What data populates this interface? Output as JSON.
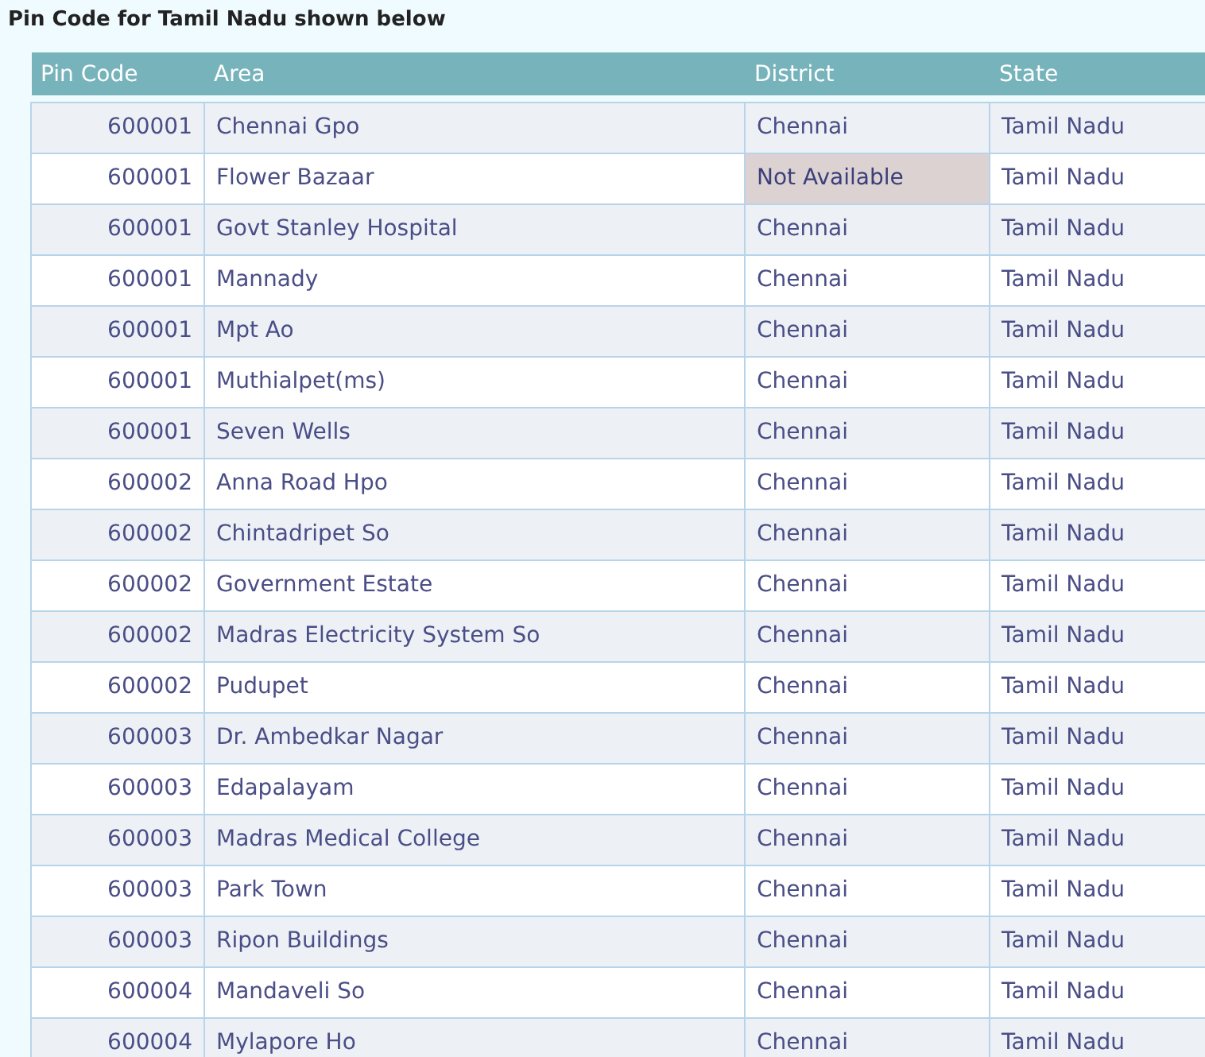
{
  "heading": "Pin Code for Tamil Nadu shown below",
  "columns": [
    "Pin Code",
    "Area",
    "District",
    "State"
  ],
  "rows": [
    {
      "pin": "600001",
      "area": "Chennai Gpo",
      "district": "Chennai",
      "state": "Tamil Nadu",
      "district_missing": false
    },
    {
      "pin": "600001",
      "area": "Flower Bazaar",
      "district": "Not Available",
      "state": "Tamil Nadu",
      "district_missing": true
    },
    {
      "pin": "600001",
      "area": "Govt Stanley Hospital",
      "district": "Chennai",
      "state": "Tamil Nadu",
      "district_missing": false
    },
    {
      "pin": "600001",
      "area": "Mannady",
      "district": "Chennai",
      "state": "Tamil Nadu",
      "district_missing": false
    },
    {
      "pin": "600001",
      "area": "Mpt Ao",
      "district": "Chennai",
      "state": "Tamil Nadu",
      "district_missing": false
    },
    {
      "pin": "600001",
      "area": "Muthialpet(ms)",
      "district": "Chennai",
      "state": "Tamil Nadu",
      "district_missing": false
    },
    {
      "pin": "600001",
      "area": "Seven Wells",
      "district": "Chennai",
      "state": "Tamil Nadu",
      "district_missing": false
    },
    {
      "pin": "600002",
      "area": "Anna Road Hpo",
      "district": "Chennai",
      "state": "Tamil Nadu",
      "district_missing": false
    },
    {
      "pin": "600002",
      "area": "Chintadripet So",
      "district": "Chennai",
      "state": "Tamil Nadu",
      "district_missing": false
    },
    {
      "pin": "600002",
      "area": "Government Estate",
      "district": "Chennai",
      "state": "Tamil Nadu",
      "district_missing": false
    },
    {
      "pin": "600002",
      "area": "Madras Electricity System So",
      "district": "Chennai",
      "state": "Tamil Nadu",
      "district_missing": false
    },
    {
      "pin": "600002",
      "area": "Pudupet",
      "district": "Chennai",
      "state": "Tamil Nadu",
      "district_missing": false
    },
    {
      "pin": "600003",
      "area": "Dr. Ambedkar Nagar",
      "district": "Chennai",
      "state": "Tamil Nadu",
      "district_missing": false
    },
    {
      "pin": "600003",
      "area": "Edapalayam",
      "district": "Chennai",
      "state": "Tamil Nadu",
      "district_missing": false
    },
    {
      "pin": "600003",
      "area": "Madras Medical College",
      "district": "Chennai",
      "state": "Tamil Nadu",
      "district_missing": false
    },
    {
      "pin": "600003",
      "area": "Park Town",
      "district": "Chennai",
      "state": "Tamil Nadu",
      "district_missing": false
    },
    {
      "pin": "600003",
      "area": "Ripon Buildings",
      "district": "Chennai",
      "state": "Tamil Nadu",
      "district_missing": false
    },
    {
      "pin": "600004",
      "area": "Mandaveli So",
      "district": "Chennai",
      "state": "Tamil Nadu",
      "district_missing": false
    },
    {
      "pin": "600004",
      "area": "Mylapore Ho",
      "district": "Chennai",
      "state": "Tamil Nadu",
      "district_missing": false
    }
  ]
}
